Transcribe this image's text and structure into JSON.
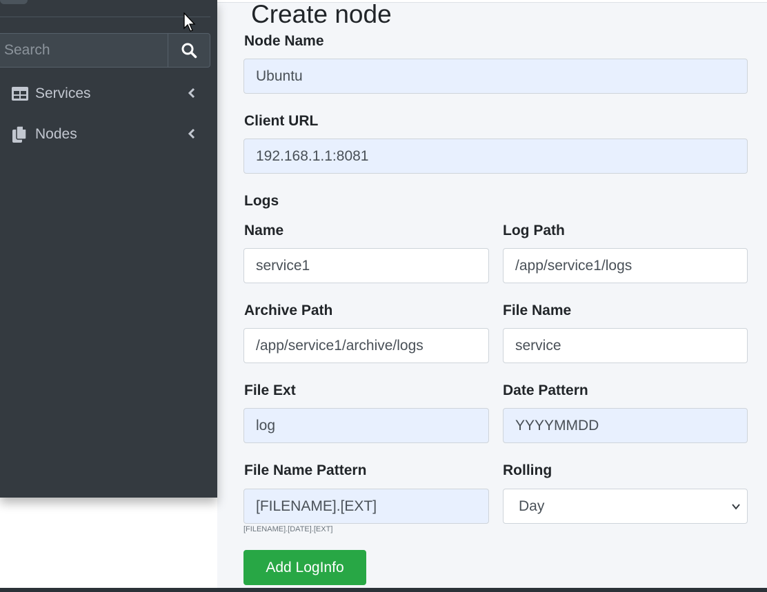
{
  "sidebar": {
    "search_placeholder": "Search",
    "items": [
      {
        "label": "Services",
        "icon": "table-icon"
      },
      {
        "label": "Nodes",
        "icon": "copy-icon"
      }
    ]
  },
  "page": {
    "title": "Create node"
  },
  "form": {
    "node_name": {
      "label": "Node Name",
      "value": "Ubuntu"
    },
    "client_url": {
      "label": "Client URL",
      "value": "192.168.1.1:8081"
    },
    "logs_heading": "Logs",
    "name": {
      "label": "Name",
      "value": "service1"
    },
    "log_path": {
      "label": "Log Path",
      "value": "/app/service1/logs"
    },
    "archive_path": {
      "label": "Archive Path",
      "value": "/app/service1/archive/logs"
    },
    "file_name": {
      "label": "File Name",
      "value": "service"
    },
    "file_ext": {
      "label": "File Ext",
      "value": "log"
    },
    "date_pattern": {
      "label": "Date Pattern",
      "value": "YYYYMMDD"
    },
    "file_name_pattern": {
      "label": "File Name Pattern",
      "value": "[FILENAME].[EXT]",
      "hint": "[FILENAME].[DATE].[EXT]"
    },
    "rolling": {
      "label": "Rolling",
      "value": "Day"
    },
    "add_button": "Add LogInfo"
  },
  "colors": {
    "sidebar_bg": "#343a40",
    "main_bg": "#f4f6f9",
    "autofill_bg": "#e8f0fe",
    "button_green": "#28a745"
  }
}
